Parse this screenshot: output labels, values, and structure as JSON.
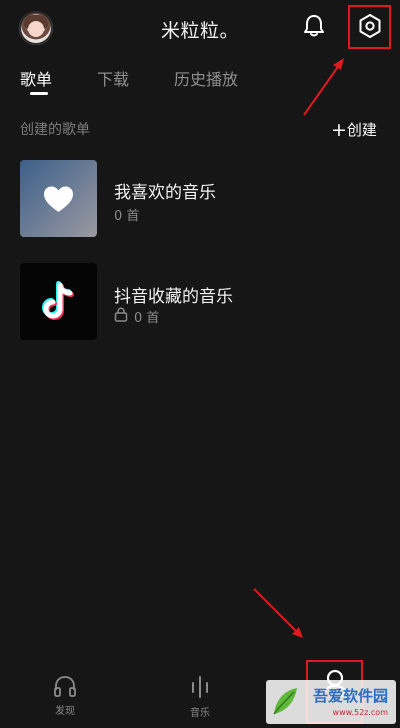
{
  "header": {
    "title": "米粒粒。",
    "avatar_icon": "user-avatar",
    "bell_icon": "bell-icon",
    "settings_icon": "settings-hexagon-icon"
  },
  "tabs": [
    {
      "label": "歌单",
      "active": true
    },
    {
      "label": "下载",
      "active": false
    },
    {
      "label": "历史播放",
      "active": false
    }
  ],
  "section": {
    "label": "创建的歌单",
    "create_label": "创建"
  },
  "playlists": [
    {
      "title": "我喜欢的音乐",
      "count": "0 首",
      "icon": "heart-icon",
      "locked": false
    },
    {
      "title": "抖音收藏的音乐",
      "count": "0 首",
      "icon": "tiktok-logo-icon",
      "locked": true
    }
  ],
  "bottom_nav": [
    {
      "label": "发现",
      "icon": "headphones-icon"
    },
    {
      "label": "音乐",
      "icon": "waveform-icon"
    },
    {
      "label": "",
      "icon": "profile-vip-icon"
    }
  ],
  "watermark": {
    "text": "吾爱软件园",
    "url": "www.52z.com"
  },
  "colors": {
    "background": "#161616",
    "annotation_red": "#e0191e",
    "muted_text": "#8a8a8a"
  }
}
